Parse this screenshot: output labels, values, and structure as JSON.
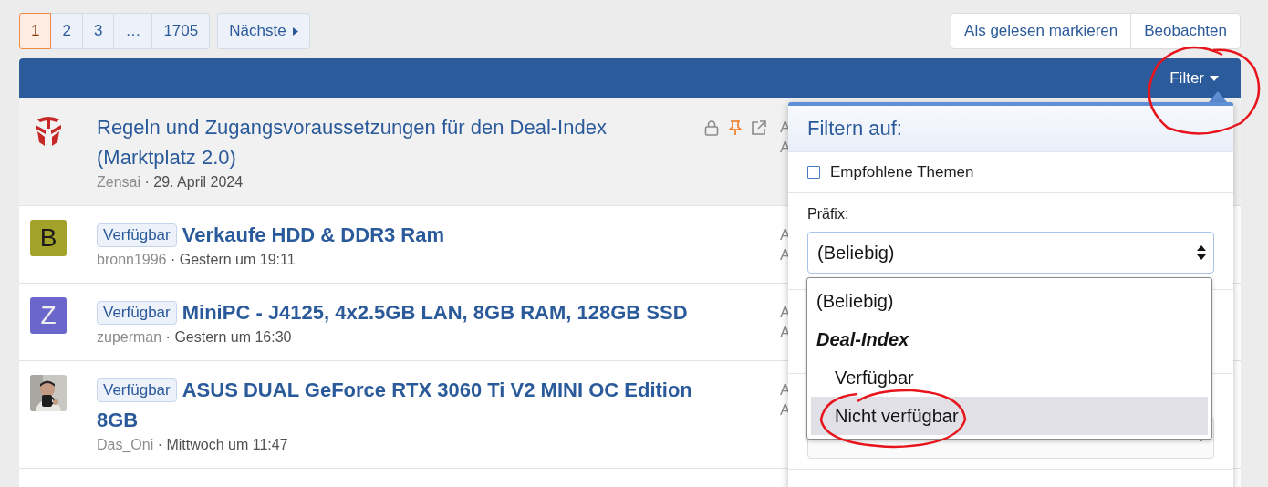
{
  "pagination": {
    "pages": [
      {
        "label": "1",
        "selected": true
      },
      {
        "label": "2",
        "selected": false
      },
      {
        "label": "3",
        "selected": false
      },
      {
        "label": "…",
        "selected": false
      },
      {
        "label": "1705",
        "selected": false
      }
    ],
    "next": "Nächste"
  },
  "actions": [
    "Als gelesen markieren",
    "Beobachten"
  ],
  "header": {
    "filter": "Filter"
  },
  "threads": [
    {
      "avatar": {
        "kind": "emblem"
      },
      "title": "Regeln und Zugangsvoraussetzungen für den Deal-Index (Marktplatz 2.0)",
      "author": "Zensai",
      "separator": "·",
      "date": "29. April 2024",
      "sticky": true,
      "locked": true,
      "pinned": true,
      "redirect": true,
      "column_3": [
        "A",
        "A"
      ]
    },
    {
      "avatar": {
        "kind": "letter",
        "letter": "B",
        "color": "#a3a32b"
      },
      "prefix": "Verfügbar",
      "title": "Verkaufe HDD & DDR3 Ram",
      "author": "bronn1996",
      "separator": "·",
      "date": "Gestern um 19:11",
      "sticky": false,
      "locked": false,
      "pinned": false,
      "redirect": false,
      "column_3": [
        "A",
        "A"
      ]
    },
    {
      "avatar": {
        "kind": "letter",
        "letter": "Z",
        "color": "#6b66cc"
      },
      "prefix": "Verfügbar",
      "title": "MiniPC - J4125, 4x2.5GB LAN, 8GB RAM, 128GB SSD",
      "author": "zuperman",
      "separator": "·",
      "date": "Gestern um 16:30",
      "sticky": false,
      "locked": false,
      "pinned": false,
      "redirect": false,
      "column_3": [
        "A",
        "A"
      ]
    },
    {
      "prefix": "Verfügbar",
      "title": "ASUS DUAL GeForce RTX 3060 Ti V2 MINI OC Edition 8GB",
      "author": "Das_Oni",
      "separator": "·",
      "date": "Mittwoch um 11:47",
      "sticky": false,
      "locked": false,
      "pinned": false,
      "redirect": false,
      "column_3": [
        "A",
        "A"
      ]
    }
  ],
  "filter_menu": {
    "title": "Filtern auf:",
    "checkbox": {
      "label": "Empfohlene Themen",
      "checked": false
    },
    "prefix_label": "Präfix:",
    "prefix_value": "(Beliebig)",
    "options": [
      {
        "kind": "option",
        "label": "(Beliebig)",
        "selected": false
      },
      {
        "kind": "group",
        "label": "Deal-Index",
        "selected": false
      },
      {
        "kind": "suboption",
        "label": "Verfügbar",
        "selected": false
      },
      {
        "kind": "suboption",
        "label": "Nicht verfügbar",
        "selected": true
      }
    ]
  }
}
